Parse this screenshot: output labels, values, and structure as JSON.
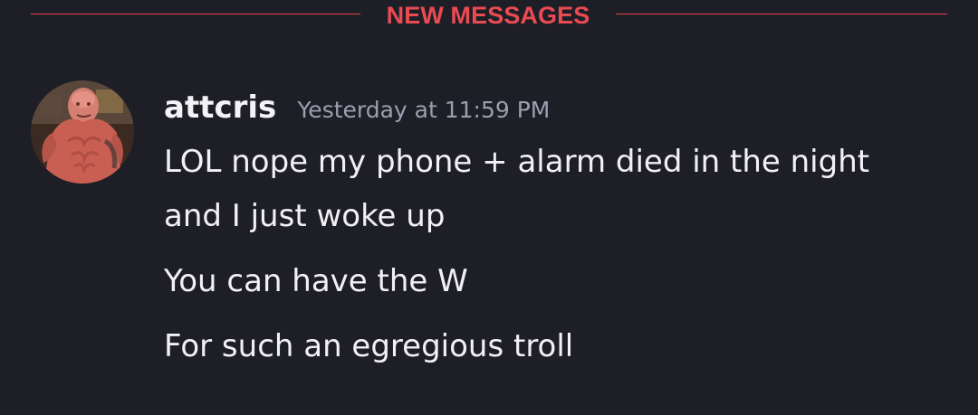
{
  "divider": {
    "label": "NEW MESSAGES"
  },
  "message": {
    "avatar_icon": "user-avatar-photo",
    "username": "attcris",
    "timestamp": "Yesterday at 11:59 PM",
    "lines": [
      "LOL nope my phone + alarm died in the night",
      "and I just woke up",
      "You can have the W",
      "For such an egregious troll"
    ]
  },
  "colors": {
    "background": "#1e1e27",
    "accent": "#ea4a52",
    "username": "#f3f3f6",
    "timestamp": "#9c9fb0",
    "message_text": "#f1f1f4"
  }
}
